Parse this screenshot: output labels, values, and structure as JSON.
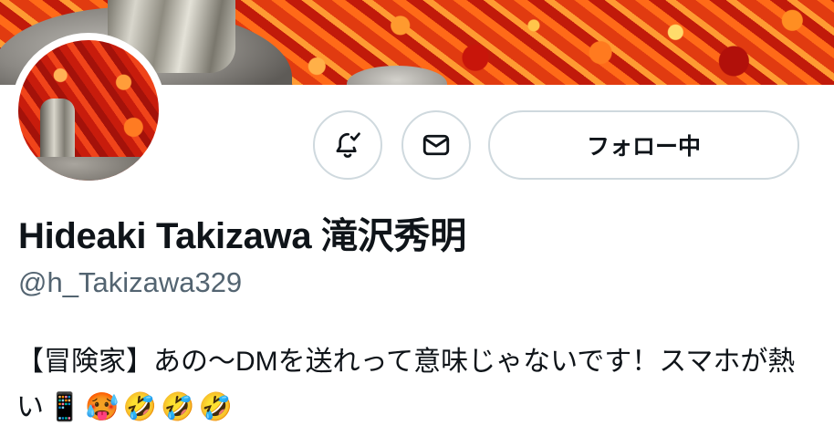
{
  "profile": {
    "display_name": "Hideaki Takizawa 滝沢秀明",
    "handle": "@h_Takizawa329",
    "bio_text": "【冒険家】あの〜DMを送れって意味じゃないです！スマホが熱い",
    "bio_emojis": [
      "📱",
      "🥵",
      "🤣",
      "🤣",
      "🤣"
    ]
  },
  "actions": {
    "notify_icon": "bell-check-icon",
    "message_icon": "mail-icon",
    "follow_label": "フォロー中"
  },
  "colors": {
    "border": "#cfd9de",
    "text": "#0f1419",
    "secondary_text": "#536471",
    "banner_accent": "#e2430f"
  }
}
